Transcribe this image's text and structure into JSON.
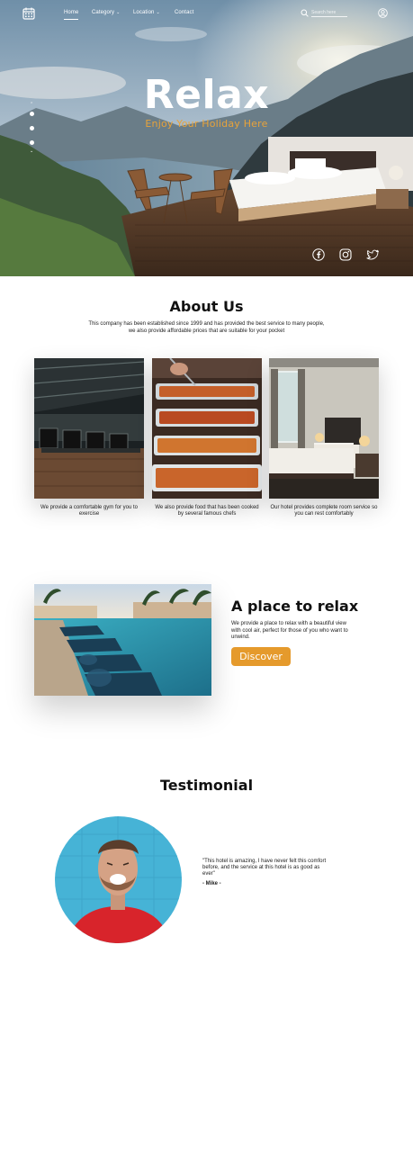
{
  "nav": {
    "logo_icon": "calendar-icon",
    "items": [
      {
        "label": "Home",
        "active": true,
        "dropdown": false
      },
      {
        "label": "Category",
        "active": false,
        "dropdown": true
      },
      {
        "label": "Location",
        "active": false,
        "dropdown": true
      },
      {
        "label": "Contact",
        "active": false,
        "dropdown": false
      }
    ],
    "search": {
      "placeholder": "Search here",
      "icon": "search-icon"
    },
    "user_icon": "user-circle-icon"
  },
  "hero": {
    "title": "Relax",
    "subtitle": "Enjoy Your Holiday Here",
    "slides": 3,
    "social": [
      "facebook-icon",
      "instagram-icon",
      "twitter-icon"
    ]
  },
  "about": {
    "title": "About Us",
    "text": "This company has been established since 1999 and has provided the best service to many people, we also provide affordable prices that are suitable for your pocket",
    "cards": [
      {
        "image": "gym",
        "caption": "We provide a comfortable gym for you to exercise"
      },
      {
        "image": "buffet",
        "caption": "We also provide food that has been cooked by several famous chefs"
      },
      {
        "image": "room",
        "caption": "Our hotel provides complete room service so you can rest comfortably"
      }
    ]
  },
  "relax": {
    "title": "A place to relax",
    "text": "We provide a place to relax with a beautiful view with cool air, perfect for those of you who want to unwind.",
    "button": "Discover"
  },
  "testimonial": {
    "title": "Testimonial",
    "quote": "\"This hotel is amazing, I have never felt this comfort before, and the service at this hotel is as good as ever\"",
    "author": "- Mike -"
  },
  "colors": {
    "accent": "#e59a2c",
    "subtitle": "#e8a33a",
    "text": "#111111"
  }
}
